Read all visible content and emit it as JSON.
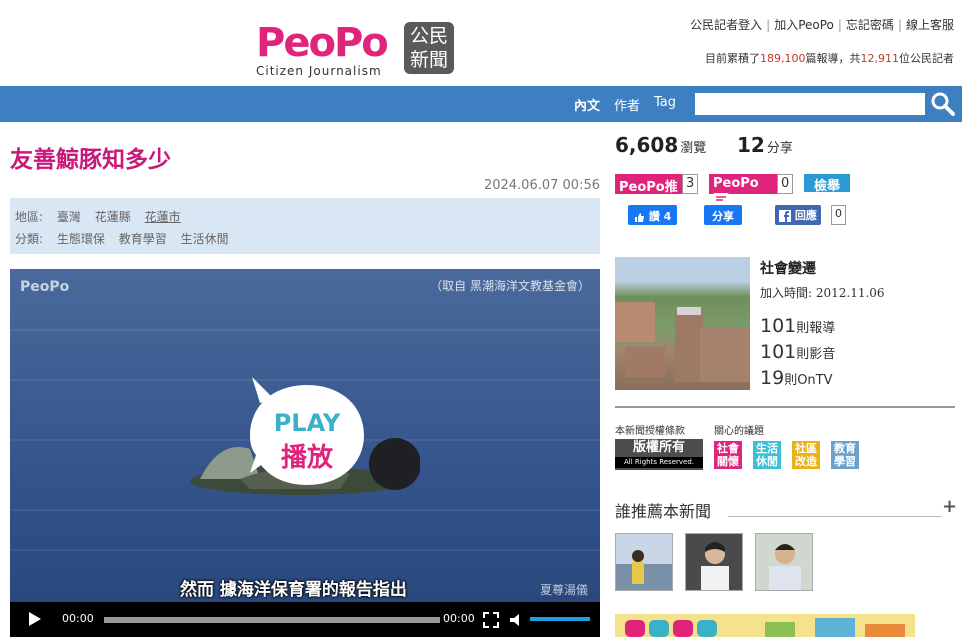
{
  "header": {
    "logo_word_peo": "Peo",
    "logo_word_po": "Po",
    "logo_box_line1": "公民",
    "logo_box_line2": "新聞",
    "logo_sub": "Citizen Journalism",
    "links": [
      "公民記者登入",
      "加入PeoPo",
      "忘記密碼",
      "線上客服"
    ],
    "stats_prefix": "目前累積了",
    "stats_reports": "189,100",
    "stats_mid": "篇報導，共",
    "stats_journalists": "12,911",
    "stats_suffix": "位公民記者"
  },
  "nav": {
    "items": [
      "內文",
      "作者",
      "Tag"
    ],
    "search_placeholder": ""
  },
  "article": {
    "title": "友善鯨豚知多少",
    "date": "2024.06.07 00:56",
    "region_label": "地區:",
    "regions": [
      "臺灣",
      "花蓮縣",
      "花蓮市"
    ],
    "category_label": "分類:",
    "categories": [
      "生態環保",
      "教育學習",
      "生活休閒"
    ]
  },
  "video": {
    "logo": "PeoPo",
    "credit": "（取自 黑潮海洋文教基金會）",
    "subtitle": "然而 據海洋保育署的報告指出",
    "signature": "夏尊湯儀",
    "play_en": "PLAY",
    "play_zh": "播放",
    "time_current": "00:00",
    "time_total": "00:00",
    "progress": 0,
    "volume": 1
  },
  "sidebar": {
    "views": "6,608",
    "views_label": "瀏覽",
    "shares": "12",
    "shares_label": "分享",
    "peopo_push": "PeoPo推",
    "push_count": "3",
    "peopo_comment": "PeoPo",
    "comment_count": "0",
    "report": "檢舉",
    "like_label": "讚 4",
    "share_label": "分享",
    "fb_reply": "回應",
    "fb_reply_count": "0",
    "author_name": "社會變遷",
    "author_join": "加入時間: 2012.11.06",
    "author_reports": "101",
    "author_reports_label": "則報導",
    "author_videos": "101",
    "author_videos_label": "則影音",
    "author_ontv": "19",
    "author_ontv_label": "則OnTV",
    "license_label": "本新聞授權條款",
    "topics_label": "關心的議題",
    "license_badge": "版權所有",
    "license_sub": "All Rights Reserved.",
    "topics": [
      {
        "text": "社會關懷",
        "color": "#e0247c"
      },
      {
        "text": "生活休閒",
        "color": "#3cc0d8"
      },
      {
        "text": "社區改造",
        "color": "#e8b31a"
      },
      {
        "text": "教育學習",
        "color": "#6ea1c9"
      }
    ],
    "recommend_title": "誰推薦本新聞",
    "recommend_plus": "+"
  },
  "colors": {
    "brand_pink": "#e0247c",
    "nav_blue": "#3d7fc1",
    "title_pink": "#c8187a"
  }
}
